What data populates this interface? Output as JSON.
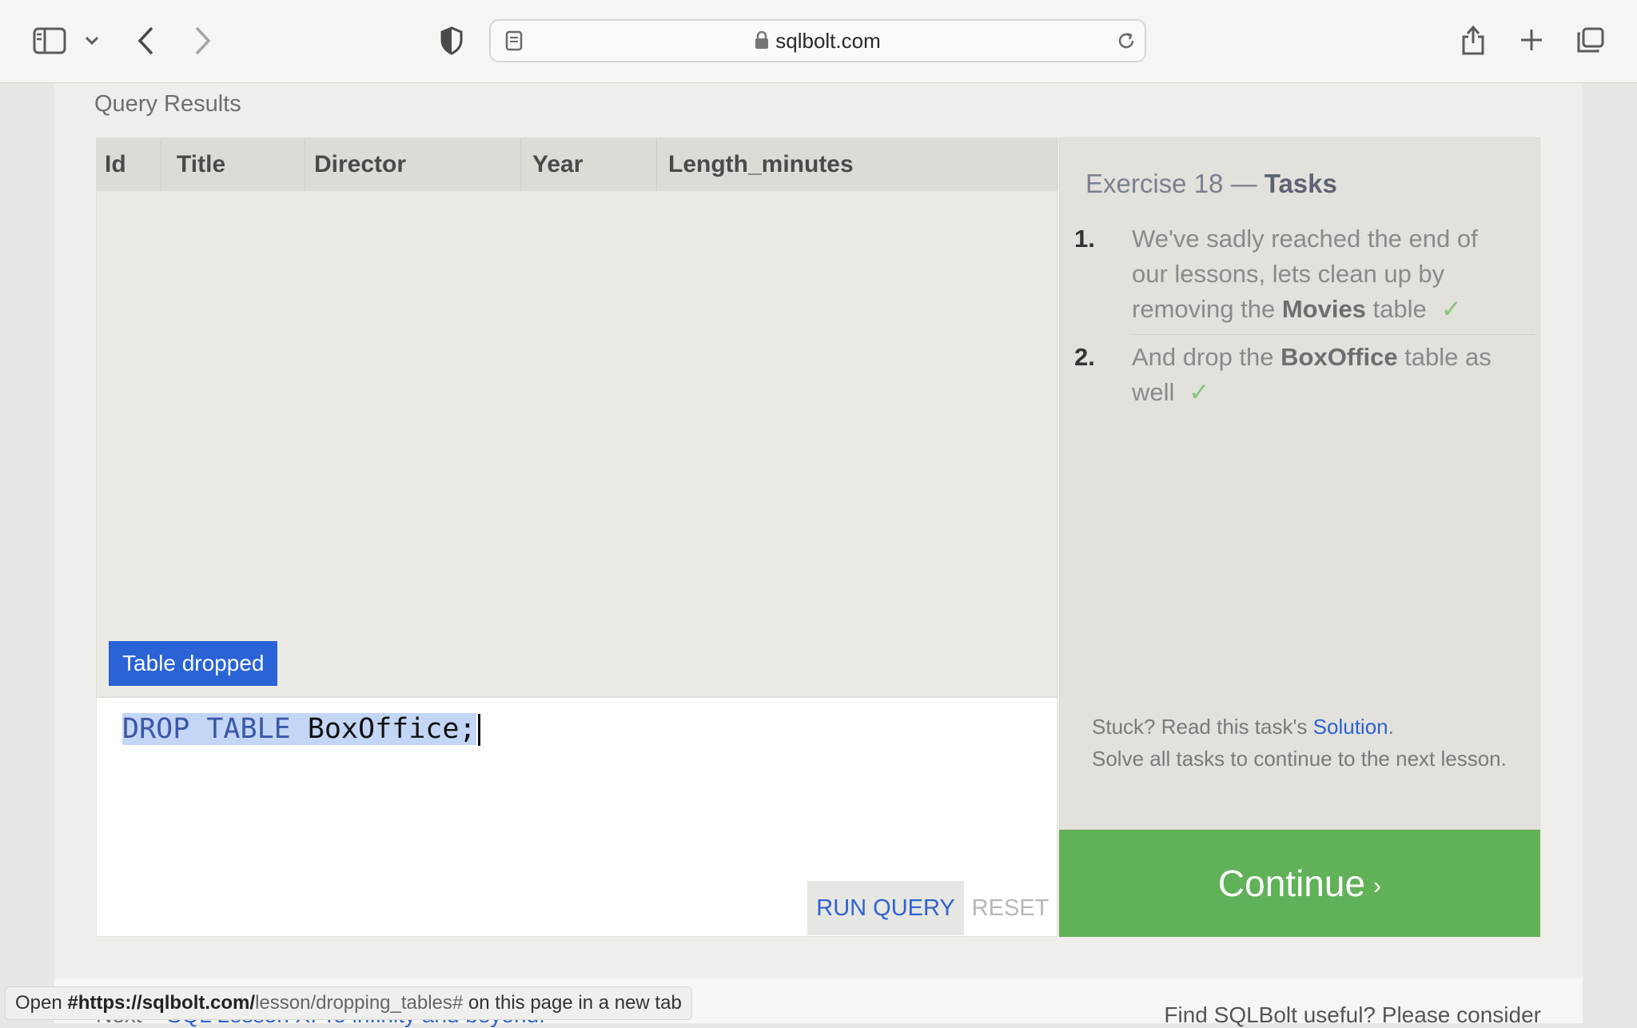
{
  "browser": {
    "url": "sqlbolt.com"
  },
  "results": {
    "label": "Query Results",
    "columns": [
      "Id",
      "Title",
      "Director",
      "Year",
      "Length_minutes"
    ],
    "toast": "Table dropped"
  },
  "editor": {
    "keyword": "DROP TABLE",
    "rest": " BoxOffice;",
    "run_label": "RUN QUERY",
    "reset_label": "RESET"
  },
  "tasks": {
    "title_prefix": "Exercise 18 — ",
    "title_strong": "Tasks",
    "items": [
      {
        "num": "1.",
        "pre": "We've sadly reached the end of our lessons, lets clean up by removing the ",
        "strong": "Movies",
        "post": " table",
        "check": "✓"
      },
      {
        "num": "2.",
        "pre": "And drop the ",
        "strong": "BoxOffice",
        "post": " table as well",
        "check": "✓"
      }
    ],
    "stuck_pre": "Stuck? Read this task's ",
    "stuck_link": "Solution",
    "stuck_post": ".",
    "solve_text": "Solve all tasks to continue to the next lesson.",
    "continue_label": "Continue",
    "continue_chevron": "›"
  },
  "footer": {
    "next_prefix": "Next – ",
    "next_link": "SQL Lesson X: To infinity and beyond!",
    "find_text": "Find SQLBolt useful? Please consider"
  },
  "status_tip": {
    "pre": "Open ",
    "bold": "#https://sqlbolt.com/",
    "dim": "lesson/dropping_tables#",
    "post": " on this page in a new tab"
  },
  "colors": {
    "accent": "#2f62d0",
    "continue": "#60b157",
    "toast": "#2a63d6",
    "check": "#86c47b"
  }
}
